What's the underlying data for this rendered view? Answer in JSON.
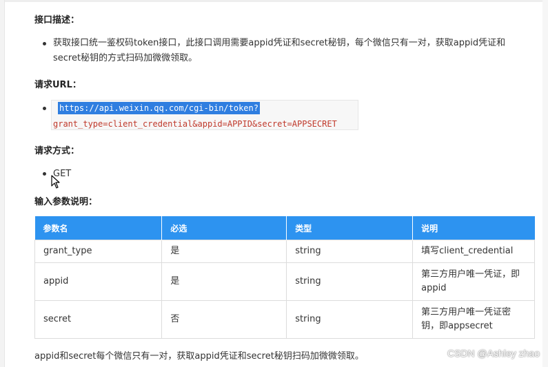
{
  "sections": {
    "interface_desc": {
      "heading": "接口描述：",
      "text": "获取接口统一鉴权码token接口，此接口调用需要appid凭证和secret秘钥，每个微信只有一对，获取appid凭证和secret秘钥的方式扫码加微微领取。"
    },
    "request_url": {
      "heading": "请求URL：",
      "url_line1": "https://api.weixin.qq.com/cgi-bin/token?",
      "url_line2": "grant_type=client_credential&appid=APPID&secret=APPSECRET"
    },
    "request_method": {
      "heading": "请求方式：",
      "method": "GET"
    },
    "params": {
      "heading": "输入参数说明：",
      "columns": [
        "参数名",
        "必选",
        "类型",
        "说明"
      ],
      "rows": [
        {
          "name": "grant_type",
          "required": "是",
          "type": "string",
          "desc": "填写client_credential"
        },
        {
          "name": "appid",
          "required": "是",
          "type": "string",
          "desc": "第三方用户唯一凭证，即appid"
        },
        {
          "name": "secret",
          "required": "否",
          "type": "string",
          "desc": "第三方用户唯一凭证密钥，即appsecret"
        }
      ]
    },
    "footer": {
      "text": "appid和secret每个微信只有一对，获取appid凭证和secret秘钥扫码加微微领取。"
    }
  },
  "watermark": "CSDN @Ashley zhao",
  "colors": {
    "table_header_bg": "#2d93f0",
    "url_highlight_bg": "#2f7ee0",
    "url_param_color": "#c0392b"
  }
}
